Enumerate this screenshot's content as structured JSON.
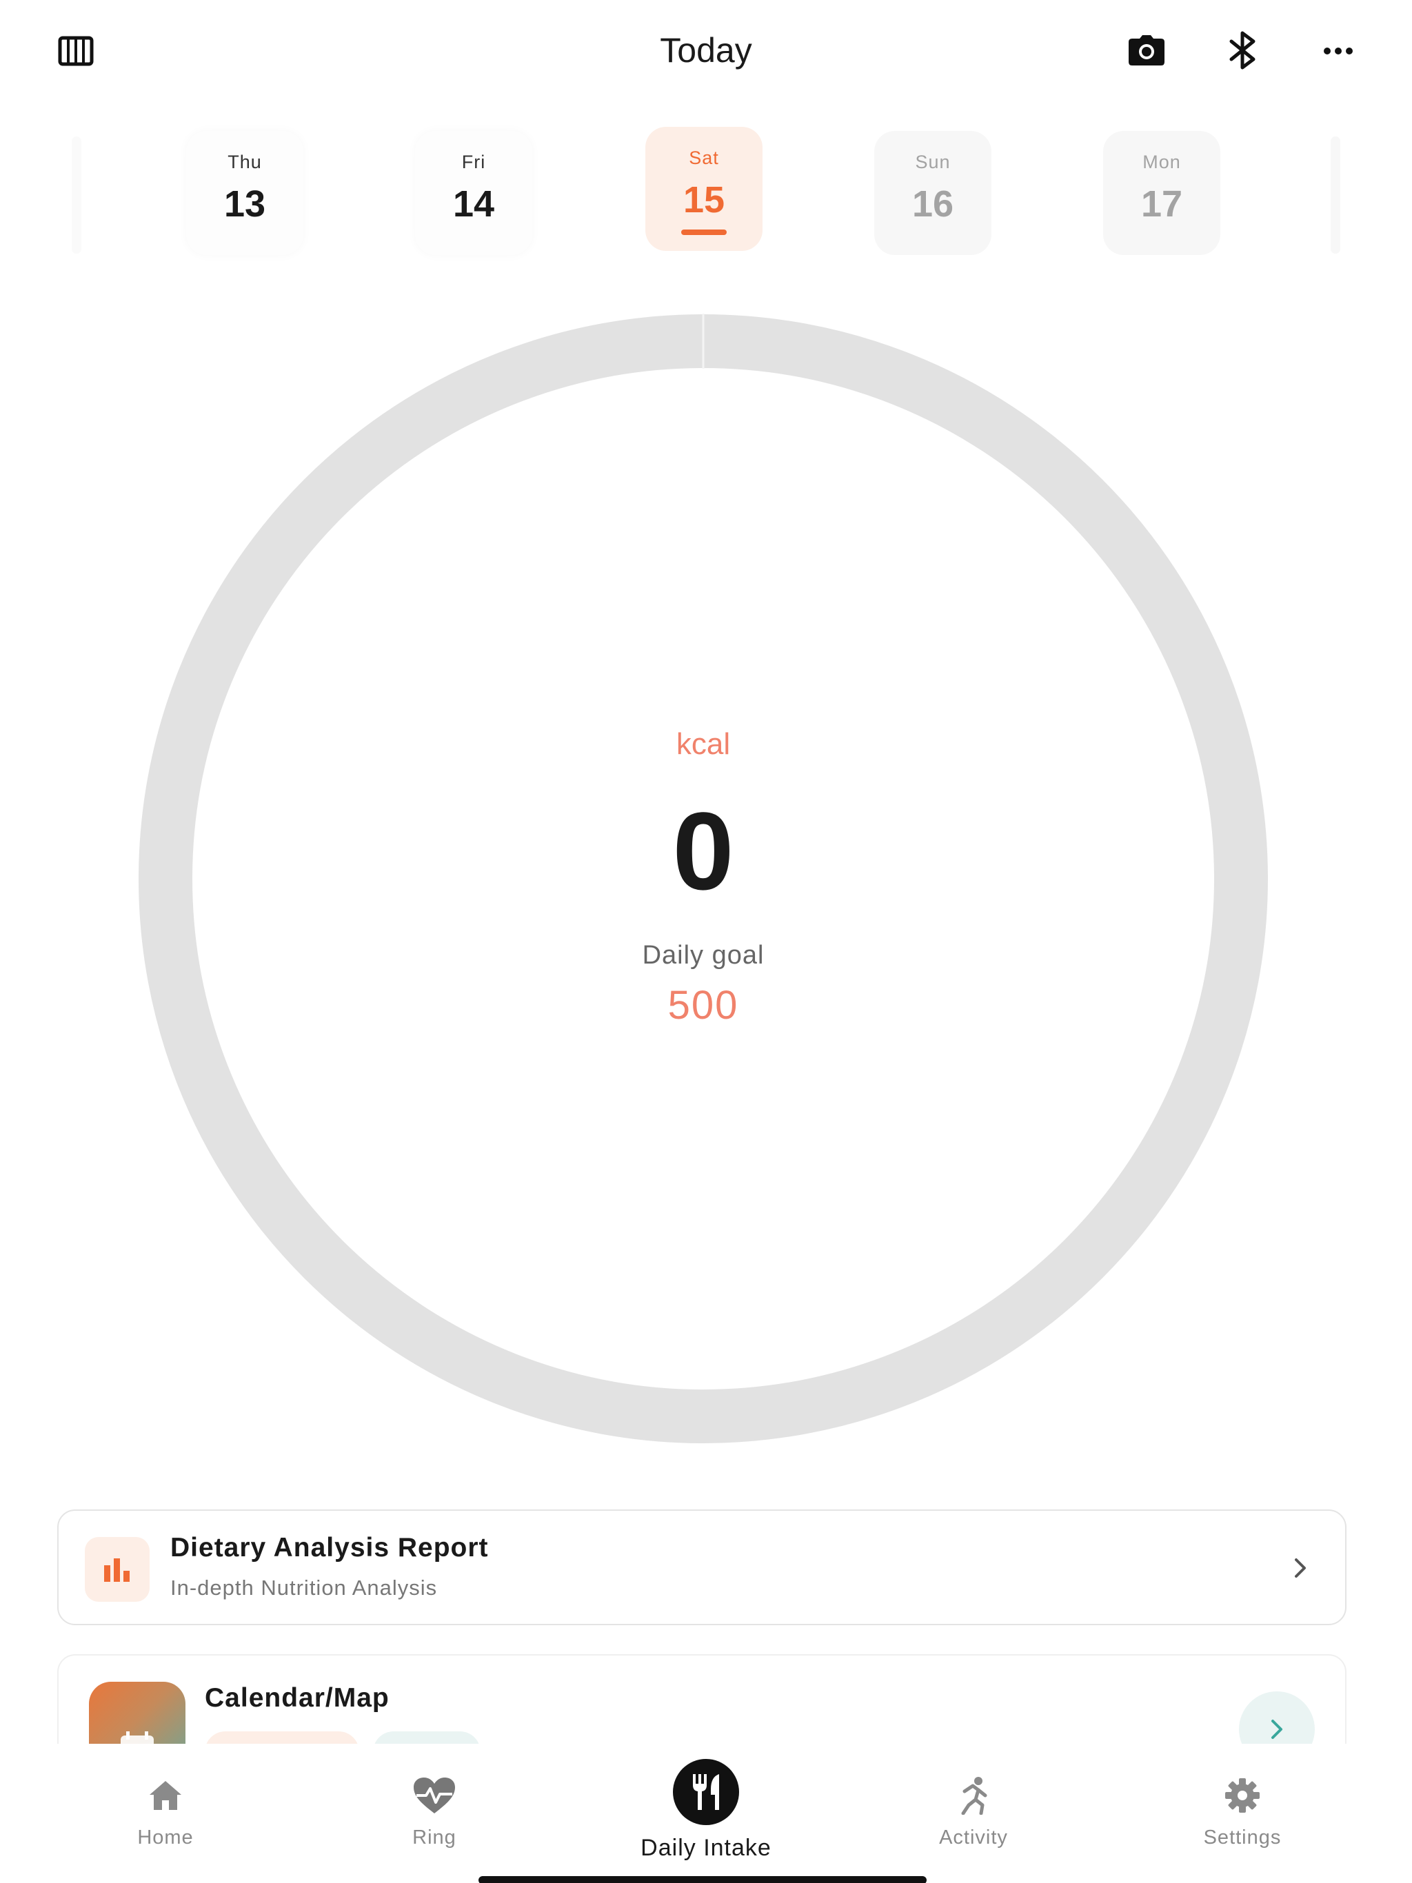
{
  "header": {
    "title": "Today",
    "icons": [
      "barcode-grid-icon",
      "camera-icon",
      "bluetooth-icon",
      "more-icon"
    ]
  },
  "dates": [
    {
      "weekday": "Thu",
      "day": "13",
      "state": "past"
    },
    {
      "weekday": "Fri",
      "day": "14",
      "state": "past"
    },
    {
      "weekday": "Sat",
      "day": "15",
      "state": "active"
    },
    {
      "weekday": "Sun",
      "day": "16",
      "state": "future"
    },
    {
      "weekday": "Mon",
      "day": "17",
      "state": "future"
    }
  ],
  "intake": {
    "unit": "kcal",
    "value": "0",
    "goal_label": "Daily goal",
    "goal_value": "500",
    "progress": 0
  },
  "report_card": {
    "title": "Dietary Analysis Report",
    "subtitle": "In-depth Nutrition Analysis"
  },
  "calendar_card": {
    "title": "Calendar/Map"
  },
  "tabs": [
    {
      "label": "Home",
      "icon": "home-icon"
    },
    {
      "label": "Ring",
      "icon": "heart-pulse-icon"
    },
    {
      "label": "Daily Intake",
      "icon": "fork-knife-icon",
      "active": true
    },
    {
      "label": "Activity",
      "icon": "running-icon"
    },
    {
      "label": "Settings",
      "icon": "gear-icon"
    }
  ],
  "colors": {
    "accent": "#f06a33",
    "accent_soft": "#fdeee6",
    "ring_track": "#e2e2e2",
    "kcal_text": "#f0826b"
  }
}
